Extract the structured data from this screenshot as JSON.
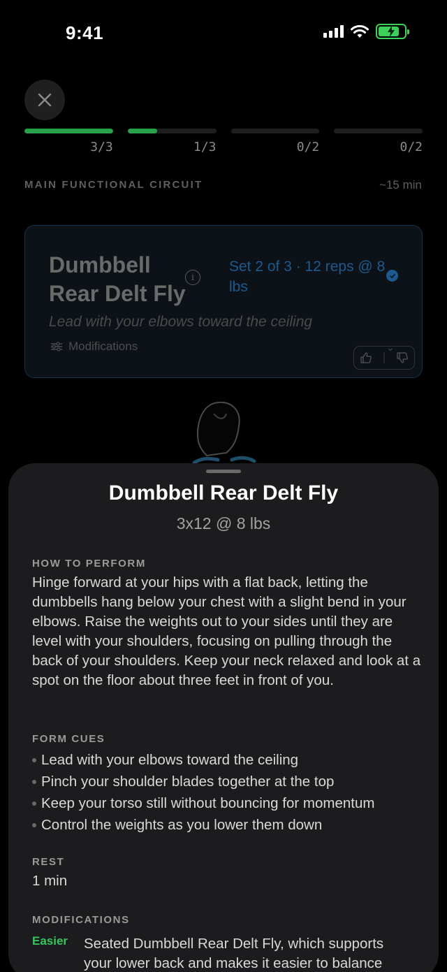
{
  "status_bar": {
    "time": "9:41",
    "icons": [
      "cellular-signal-icon",
      "wifi-icon",
      "battery-charging-icon"
    ],
    "battery_color": "#3bd15a"
  },
  "header": {
    "close_icon": "close-icon"
  },
  "progress": {
    "segments": [
      {
        "count": "3/3",
        "fraction": 1.0
      },
      {
        "count": "1/3",
        "fraction": 0.33
      },
      {
        "count": "0/2",
        "fraction": 0
      },
      {
        "count": "0/2",
        "fraction": 0
      }
    ],
    "accent": "#27a24a"
  },
  "circuit": {
    "title": "MAIN FUNCTIONAL CIRCUIT",
    "duration": "~15 min"
  },
  "exercise_card": {
    "name": "Dumbbell Rear Delt Fly",
    "info_icon": "info-icon",
    "set_info": "Set 2 of 3 · 12 reps @ 8 lbs",
    "cue": "Lead with your elbows toward the ceiling",
    "modifications_label": "Modifications",
    "feedback_icons": [
      "thumbs-up-icon",
      "thumbs-down-icon"
    ]
  },
  "sheet": {
    "title": "Dumbbell Rear Delt Fly",
    "subtitle": "3x12 @ 8 lbs",
    "how_to_heading": "HOW TO PERFORM",
    "how_to_text": "Hinge forward at your hips with a flat back, letting the dumbbells hang below your chest with a slight bend in your elbows. Raise the weights out to your sides until they are level with your shoulders, focusing on pulling through the back of your shoulders. Keep your neck relaxed and look at a spot on the floor about three feet in front of you.",
    "form_cues_heading": "FORM CUES",
    "form_cues": [
      "Lead with your elbows toward the ceiling",
      "Pinch your shoulder blades together at the top",
      "Keep your torso still without bouncing for momentum",
      "Control the weights as you lower them down"
    ],
    "rest_heading": "REST",
    "rest_value": "1 min",
    "modifications_heading": "MODIFICATIONS",
    "modifications": [
      {
        "level": "Easier",
        "text": "Seated Dumbbell Rear Delt Fly, which supports your lower back and makes it easier to balance"
      }
    ]
  }
}
